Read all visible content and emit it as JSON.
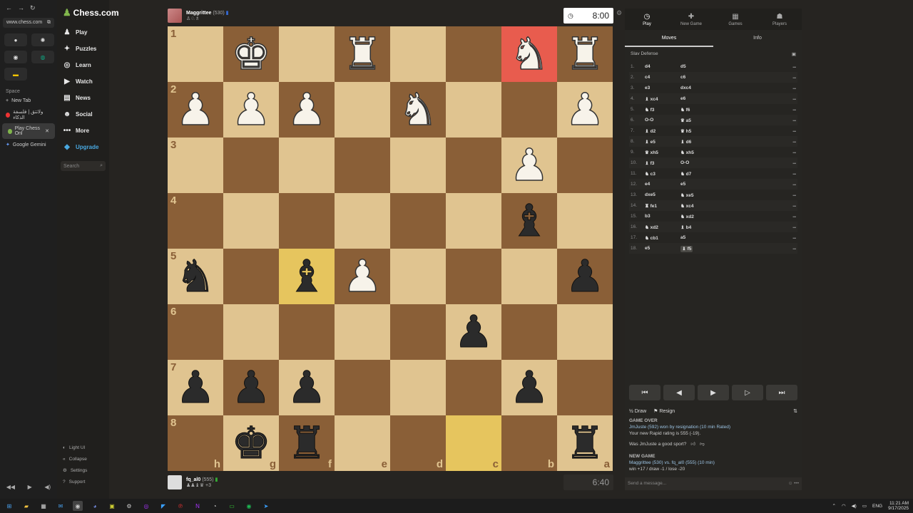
{
  "browser": {
    "url": "www.chess.com",
    "space_label": "Space",
    "tabs": [
      {
        "label": "New Tab",
        "icon": "plus-icon"
      },
      {
        "label": "ولاتتق | فلسفة الذكاء",
        "icon": "youtube-icon"
      },
      {
        "label": "Play Chess Onl",
        "icon": "chess-icon",
        "active": true
      },
      {
        "label": "Google Gemini",
        "icon": "gemini-icon"
      }
    ]
  },
  "sidebar": {
    "logo": "Chess.com",
    "items": [
      {
        "label": "Play",
        "icon": "♟"
      },
      {
        "label": "Puzzles",
        "icon": "✦"
      },
      {
        "label": "Learn",
        "icon": "◎"
      },
      {
        "label": "Watch",
        "icon": "▶"
      },
      {
        "label": "News",
        "icon": "▤"
      },
      {
        "label": "Social",
        "icon": "☻"
      },
      {
        "label": "More",
        "icon": "•••"
      },
      {
        "label": "Upgrade",
        "icon": "◆"
      }
    ],
    "search_placeholder": "Search",
    "bottom": [
      {
        "label": "Light UI",
        "icon": "◐"
      },
      {
        "label": "Collapse",
        "icon": "«"
      },
      {
        "label": "Settings",
        "icon": "⚙"
      },
      {
        "label": "Support",
        "icon": "?"
      }
    ]
  },
  "top_player": {
    "name": "Maggrittee",
    "rating": "(530)",
    "clock": "8:00"
  },
  "bottom_player": {
    "name": "fq_al0",
    "rating": "(555)",
    "captured": "+3",
    "clock": "6:40"
  },
  "board": {
    "ranks": [
      "1",
      "2",
      "3",
      "4",
      "5",
      "6",
      "7",
      "8"
    ],
    "files": [
      "h",
      "g",
      "f",
      "e",
      "d",
      "c",
      "b",
      "a"
    ],
    "pieces": [
      [
        "",
        "wK",
        "",
        "wR",
        "",
        "",
        "wN",
        "wR"
      ],
      [
        "wP",
        "wP",
        "wP",
        "",
        "wN",
        "",
        "",
        "wP"
      ],
      [
        "",
        "",
        "",
        "",
        "",
        "",
        "wP",
        ""
      ],
      [
        "",
        "",
        "",
        "",
        "",
        "",
        "bB",
        ""
      ],
      [
        "bN",
        "",
        "bB",
        "wP",
        "",
        "",
        "",
        "bP"
      ],
      [
        "",
        "",
        "",
        "",
        "",
        "bP",
        "",
        ""
      ],
      [
        "bP",
        "bP",
        "bP",
        "",
        "",
        "",
        "bP",
        ""
      ],
      [
        "",
        "bK",
        "bR",
        "",
        "",
        "",
        "",
        "bR"
      ]
    ],
    "highlights": [
      {
        "row": 0,
        "col": 6,
        "type": "red"
      },
      {
        "row": 4,
        "col": 2,
        "type": "yellow"
      },
      {
        "row": 7,
        "col": 5,
        "type": "yellow"
      }
    ]
  },
  "panel": {
    "tabs": [
      {
        "label": "Play",
        "icon": "◷",
        "active": true
      },
      {
        "label": "New Game",
        "icon": "✚"
      },
      {
        "label": "Games",
        "icon": "▦"
      },
      {
        "label": "Players",
        "icon": "☗"
      }
    ],
    "sub_tabs": [
      "Moves",
      "Info"
    ],
    "opening": "Slav Defense",
    "moves": [
      {
        "n": "1.",
        "w": "d4",
        "b": "d5"
      },
      {
        "n": "2.",
        "w": "c4",
        "b": "c6"
      },
      {
        "n": "3.",
        "w": "e3",
        "b": "dxc4"
      },
      {
        "n": "4.",
        "w": "♝ xc4",
        "b": "e6"
      },
      {
        "n": "5.",
        "w": "♞ f3",
        "b": "♞ f6"
      },
      {
        "n": "6.",
        "w": "O-O",
        "b": "♛ a5"
      },
      {
        "n": "7.",
        "w": "♝ d2",
        "b": "♛ h5"
      },
      {
        "n": "8.",
        "w": "♝ e5",
        "b": "♝ d6"
      },
      {
        "n": "9.",
        "w": "♛ xh5",
        "b": "♞ xh5"
      },
      {
        "n": "10.",
        "w": "♝ f3",
        "b": "O-O"
      },
      {
        "n": "11.",
        "w": "♞ c3",
        "b": "♞ d7"
      },
      {
        "n": "12.",
        "w": "e4",
        "b": "e5"
      },
      {
        "n": "13.",
        "w": "dxe5",
        "b": "♞ xe5"
      },
      {
        "n": "14.",
        "w": "♜ fe1",
        "b": "♞ xc4"
      },
      {
        "n": "15.",
        "w": "b3",
        "b": "♞ xd2"
      },
      {
        "n": "16.",
        "w": "♞ xd2",
        "b": "♝ b4"
      },
      {
        "n": "17.",
        "w": "♞ cb1",
        "b": "a5"
      },
      {
        "n": "18.",
        "w": "e5",
        "b": "♝ f5"
      }
    ],
    "controls": [
      "⏮",
      "◀",
      "▶",
      "▷",
      "⏭"
    ],
    "draw_label": "Draw",
    "resign_label": "Resign",
    "log": {
      "game_over": "GAME OVER",
      "result_line": "JmJuste (592) won by resignation (10 min Rated)",
      "rating_line": "Your new Rapid rating is 555 (-19).",
      "sport_q": "Was JmJuste a good sport?",
      "new_game": "NEW GAME",
      "match_line": "Maggrittee (530) vs. fq_al0 (555) (10 min)",
      "stakes_line": "win +17 / draw -1 / lose -20"
    },
    "message_placeholder": "Send a message..."
  },
  "taskbar": {
    "lang": "ENG",
    "time": "11:21 AM",
    "date": "9/17/2025"
  }
}
